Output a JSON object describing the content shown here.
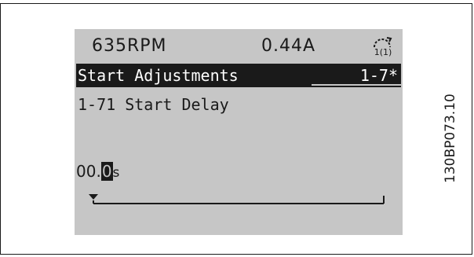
{
  "status": {
    "speed": "635RPM",
    "current": "0.44A",
    "mode_icon": "hand-on-icon",
    "mode_icon_text": "1(1)"
  },
  "group": {
    "title": "Start Adjustments",
    "number": "1-7*"
  },
  "parameter": {
    "title": "1-71 Start Delay",
    "value_prefix": "00.",
    "value_cursor_digit": "0",
    "unit": "s"
  },
  "slider": {
    "level": 0
  },
  "figure_code": "130BP073.10",
  "colors": {
    "lcd_background": "#c6c6c6",
    "lcd_ink": "#1a1a1a",
    "highlight_text": "#ffffff"
  }
}
